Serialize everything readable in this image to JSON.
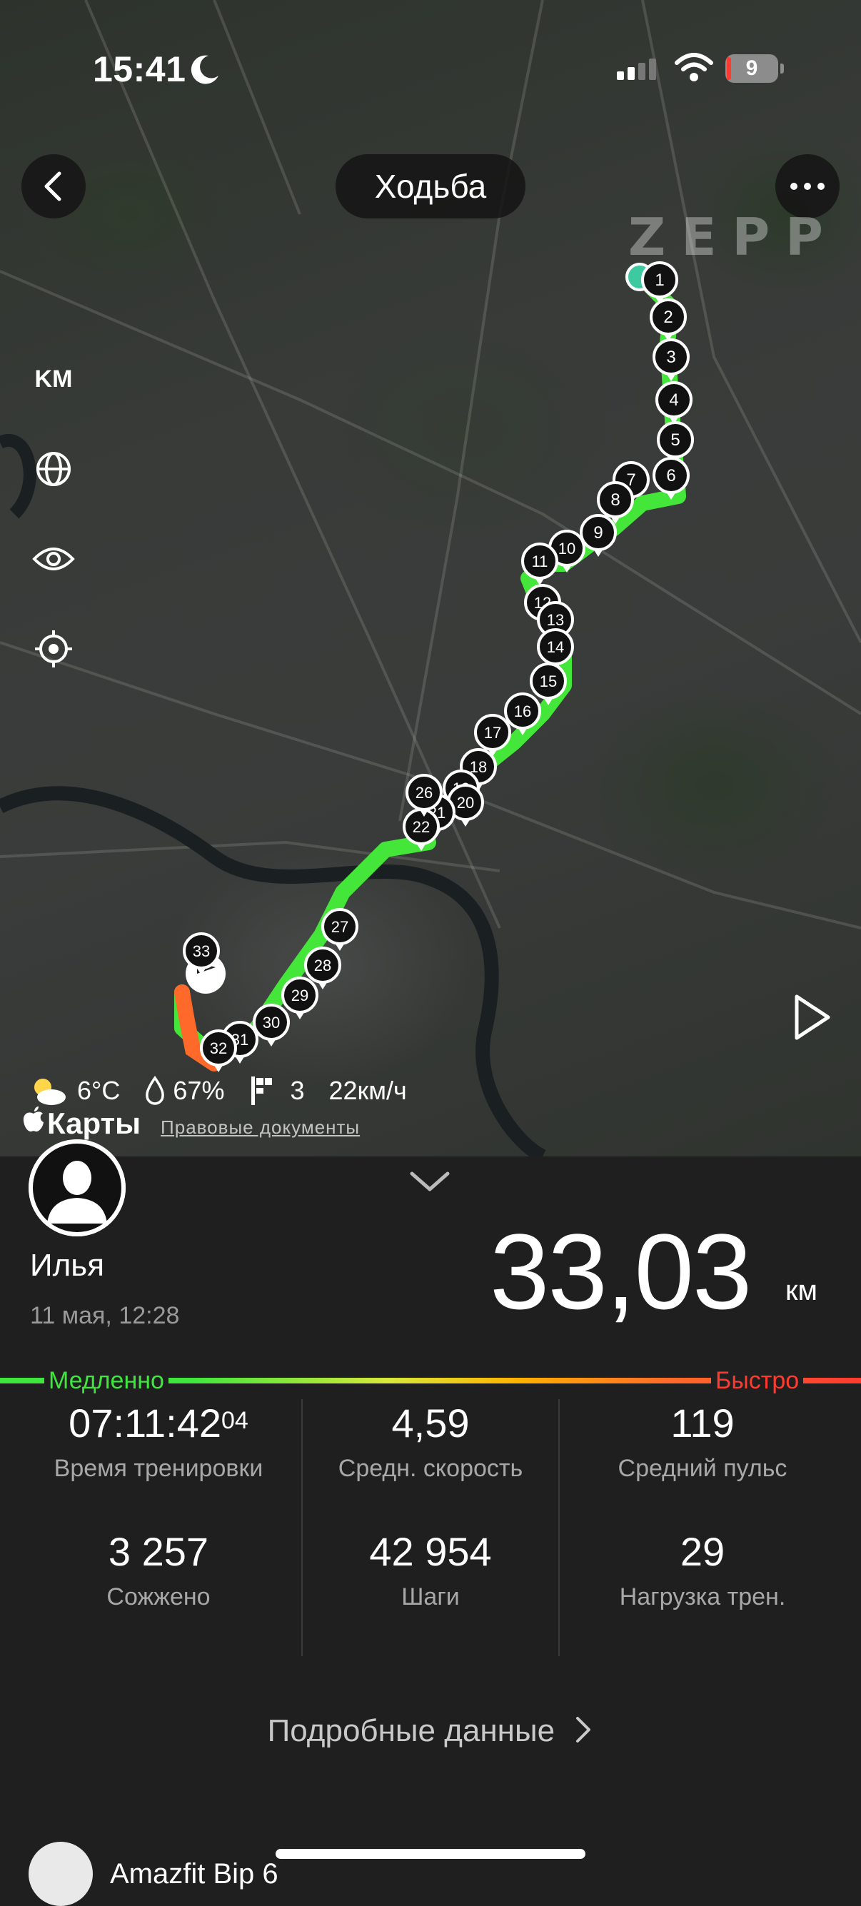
{
  "status_bar": {
    "time": "15:41",
    "battery": "9"
  },
  "header": {
    "title": "Ходьба"
  },
  "map": {
    "brand_logo": "ZEPP",
    "unit_toggle": "KM",
    "route_markers": [
      "1",
      "2",
      "3",
      "4",
      "5",
      "6",
      "7",
      "8",
      "9",
      "10",
      "11",
      "12",
      "13",
      "14",
      "15",
      "16",
      "17",
      "18",
      "19",
      "20",
      "21",
      "22",
      "26",
      "27",
      "28",
      "29",
      "30",
      "31",
      "32",
      "33"
    ],
    "route_colors": {
      "slow": "#3ee63e",
      "fast": "#ff6a2a"
    }
  },
  "weather": {
    "temperature": "6°C",
    "humidity": "67%",
    "wind_level": "3",
    "wind_speed": "22км/ч"
  },
  "attribution": {
    "maps": "Карты",
    "legal": "Правовые документы"
  },
  "summary": {
    "user_name": "Илья",
    "date": "11 мая, 12:28",
    "distance_value": "33,03",
    "distance_unit": "км"
  },
  "speed_scale": {
    "slow_label": "Медленно",
    "fast_label": "Быстро"
  },
  "stats": [
    {
      "value": "07:11:42",
      "value_suffix": "04",
      "label": "Время тренировки"
    },
    {
      "value": "4,59",
      "label": "Средн. скорость"
    },
    {
      "value": "119",
      "label": "Средний пульс"
    },
    {
      "value": "3 257",
      "label": "Сожжено"
    },
    {
      "value": "42 954",
      "label": "Шаги"
    },
    {
      "value": "29",
      "label": "Нагрузка трен."
    }
  ],
  "details_link": "Подробные данные",
  "device": {
    "name": "Amazfit Bip 6"
  }
}
